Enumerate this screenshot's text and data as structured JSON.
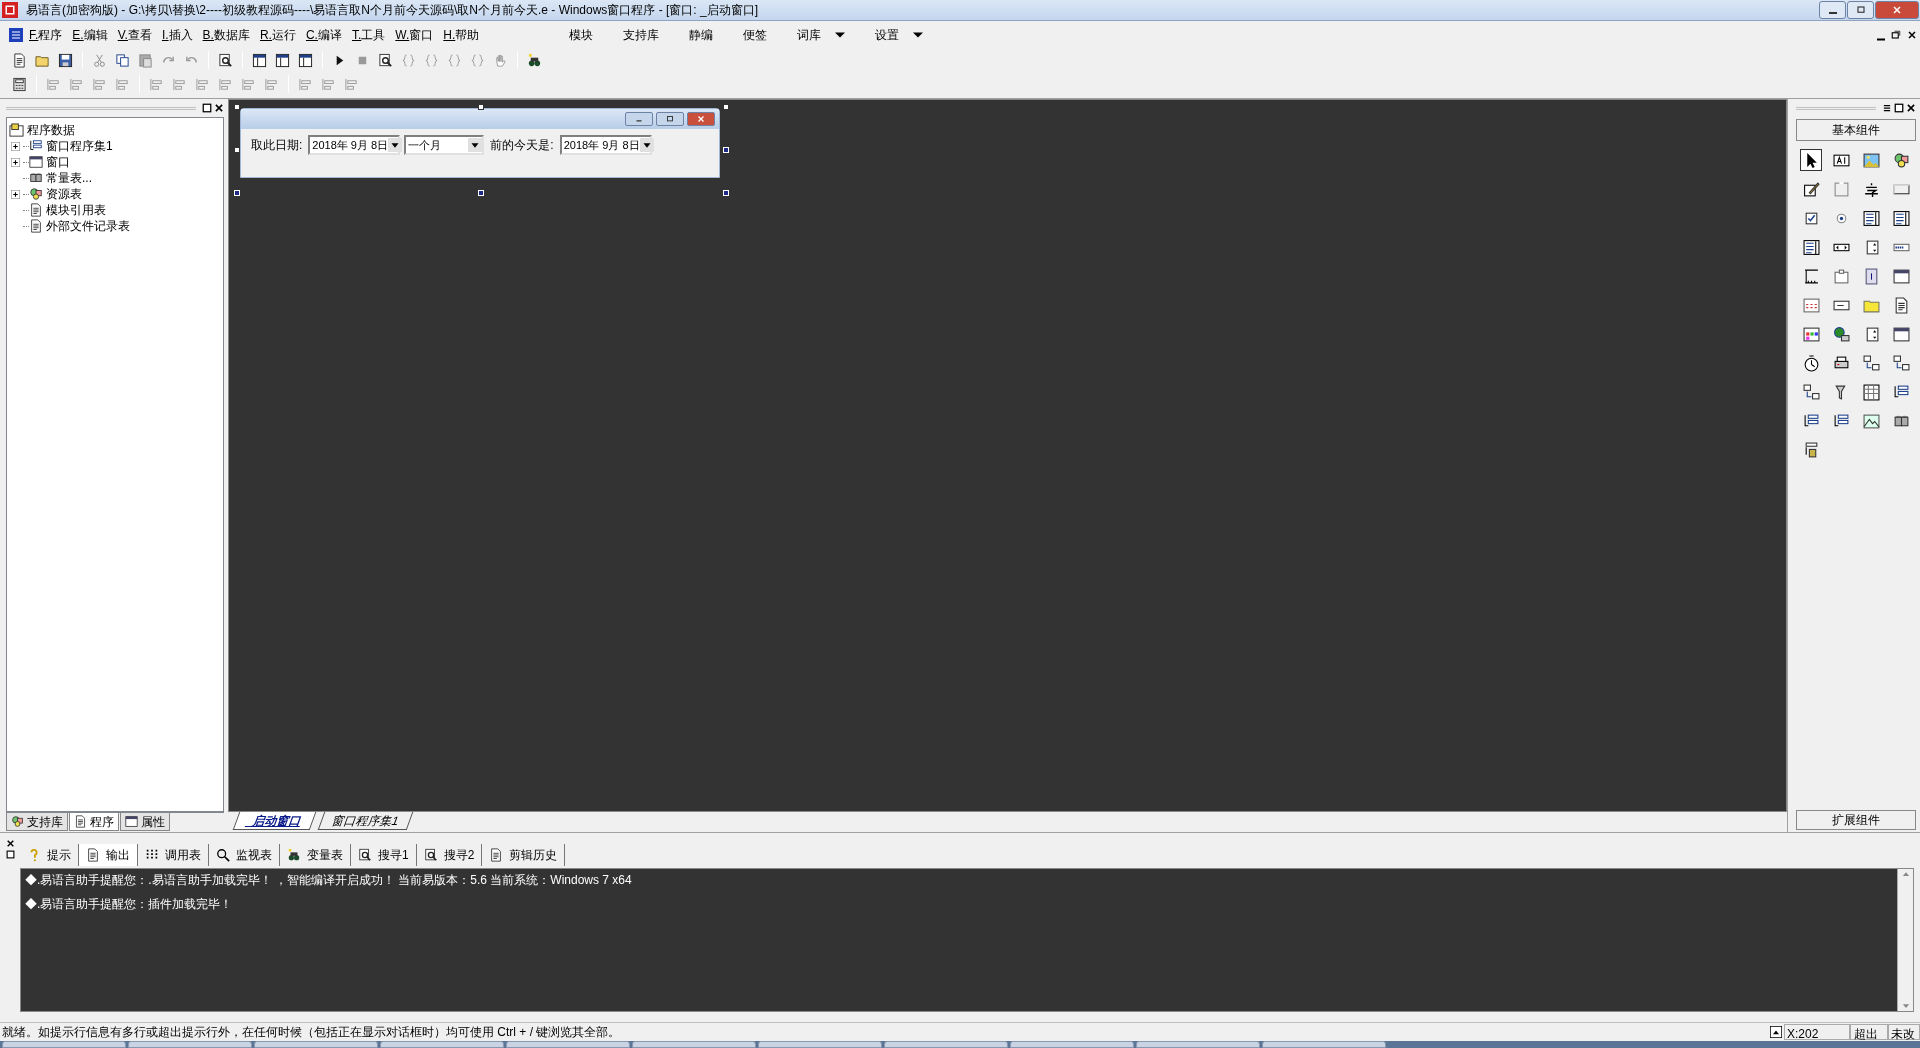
{
  "window": {
    "title": "易语言(加密狗版) - G:\\拷贝\\替换\\2----初级教程源码----\\易语言取N个月前今天源码\\取N个月前今天.e - Windows窗口程序 - [窗口: _启动窗口]"
  },
  "menu": {
    "items": [
      "F.程序",
      "E.编辑",
      "V.查看",
      "I.插入",
      "B.数据库",
      "R.运行",
      "C.编译",
      "T.工具",
      "W.窗口",
      "H.帮助"
    ],
    "extras": [
      {
        "label": "模块",
        "dropdown": false
      },
      {
        "label": "支持库",
        "dropdown": false
      },
      {
        "label": "静编",
        "dropdown": false
      },
      {
        "label": "便签",
        "dropdown": false
      },
      {
        "label": "词库",
        "dropdown": true
      },
      {
        "label": "设置",
        "dropdown": true
      }
    ]
  },
  "tree": {
    "label": "程序数据",
    "children": [
      {
        "label": "窗口程序集1",
        "kind": "branch",
        "expanded": false
      },
      {
        "label": "窗口",
        "kind": "branch",
        "expanded": false
      },
      {
        "label": "常量表...",
        "kind": "leaf"
      },
      {
        "label": "资源表",
        "kind": "branch",
        "expanded": false
      },
      {
        "label": "模块引用表",
        "kind": "leaf"
      },
      {
        "label": "外部文件记录表",
        "kind": "leaf"
      }
    ]
  },
  "left_tabs": [
    {
      "label": "支持库",
      "selected": false
    },
    {
      "label": "程序",
      "selected": true
    },
    {
      "label": "属性",
      "selected": false
    }
  ],
  "designer": {
    "form": {
      "controls": [
        {
          "kind": "label",
          "text": "取此日期:"
        },
        {
          "kind": "combo",
          "value": "2018年 9月 8日"
        },
        {
          "kind": "combo",
          "value": "一个月"
        },
        {
          "kind": "label",
          "text": "前的今天是:"
        },
        {
          "kind": "combo",
          "value": "2018年 9月 8日"
        }
      ]
    },
    "tabs": [
      {
        "label": "_启动窗口",
        "selected": true
      },
      {
        "label": "窗口程序集1",
        "selected": false
      }
    ]
  },
  "components": {
    "title": "基本组件",
    "footer": "扩展组件"
  },
  "output": {
    "tabs": [
      {
        "label": "提示",
        "selected": false
      },
      {
        "label": "输出",
        "selected": true
      },
      {
        "label": "调用表",
        "selected": false
      },
      {
        "label": "监视表",
        "selected": false
      },
      {
        "label": "变量表",
        "selected": false
      },
      {
        "label": "搜寻1",
        "selected": false
      },
      {
        "label": "搜寻2",
        "selected": false
      },
      {
        "label": "剪辑历史",
        "selected": false
      }
    ],
    "lines": [
      "◆.易语言助手提醒您：.易语言助手加载完毕！ ，智能编译开启成功！ 当前易版本：5.6 当前系统：Windows 7 x64",
      "◆.易语言助手提醒您：插件加载完毕！"
    ]
  },
  "status_bar": {
    "message": "就绪。如提示行信息有多行或超出提示行外，在任何时候（包括正在显示对话框时）均可使用 Ctrl + / 键浏览其全部。",
    "position": "X:202",
    "mode": "超出",
    "modified": "未改"
  }
}
